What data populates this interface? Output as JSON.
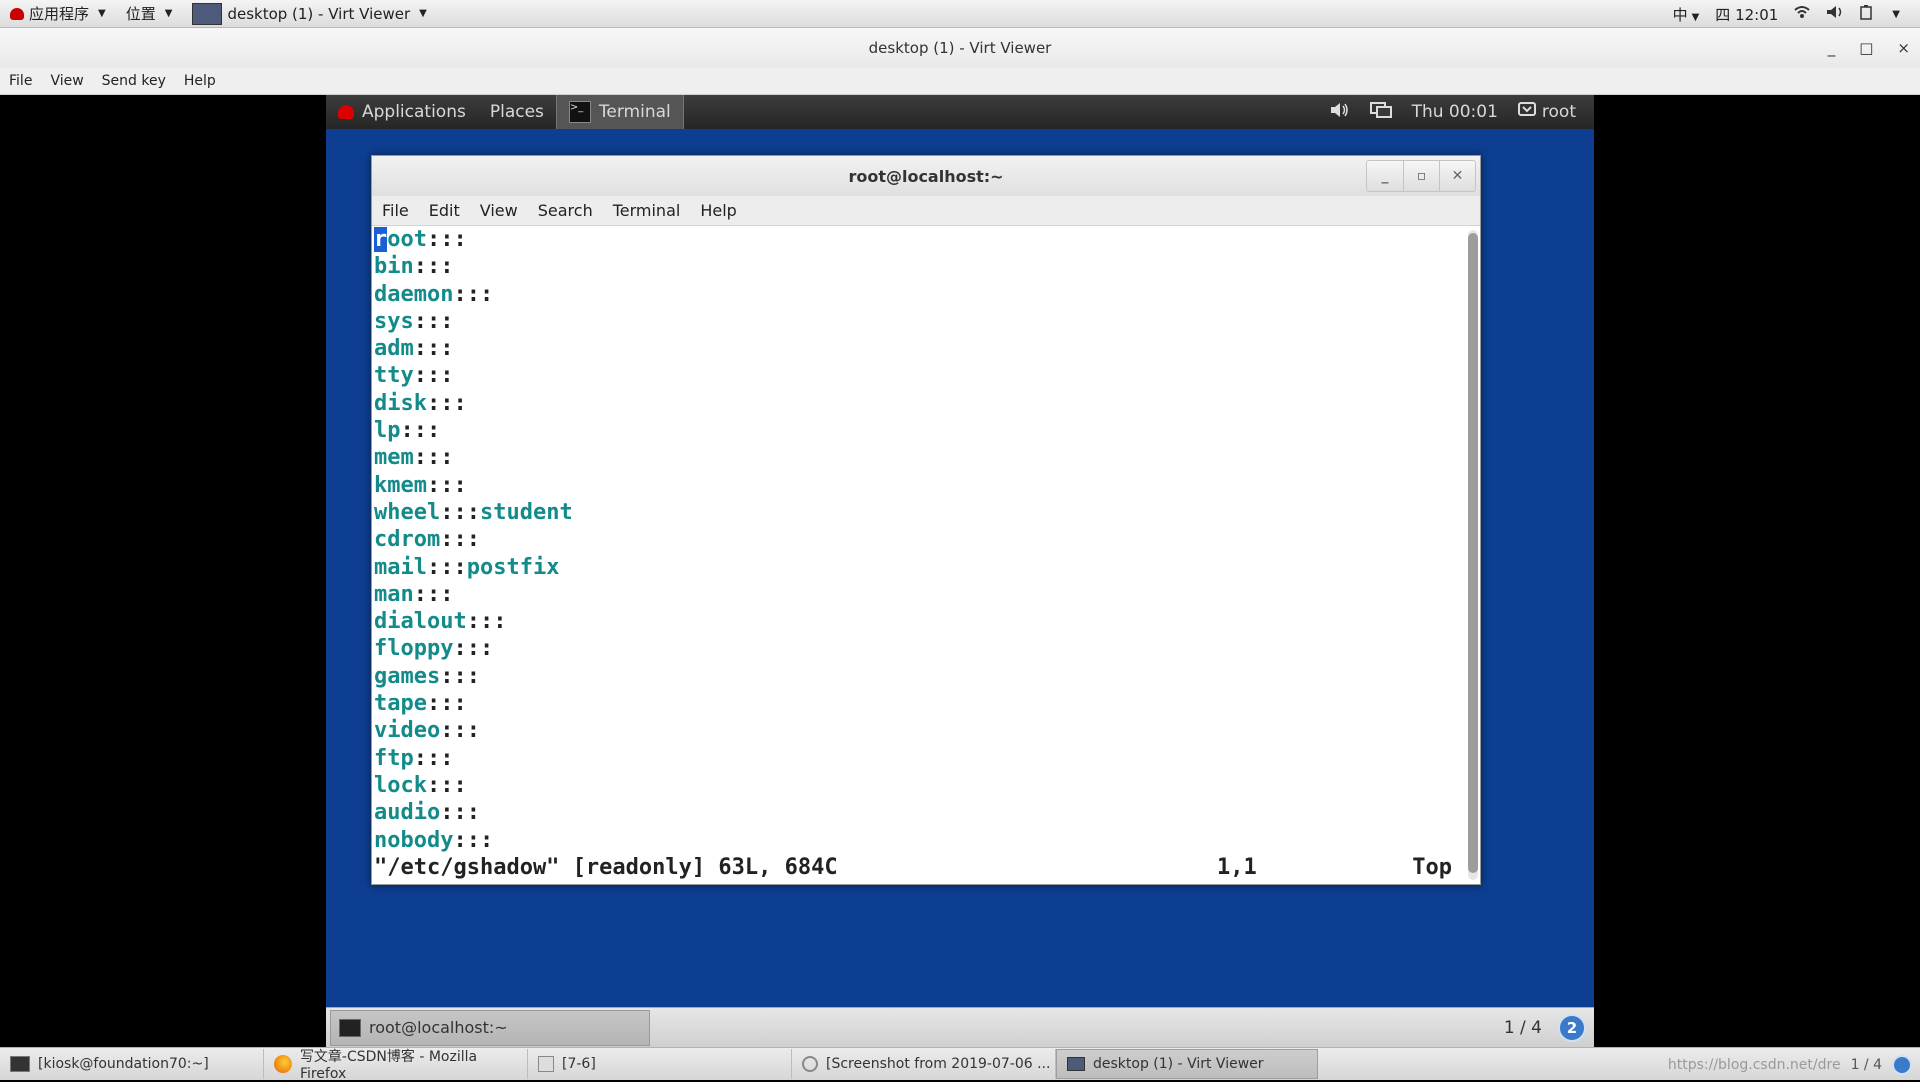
{
  "host_panel": {
    "apps": "应用程序",
    "places": "位置",
    "window_task": "desktop (1) - Virt Viewer",
    "input_method": "中",
    "clock": "四 12:01"
  },
  "viewer": {
    "title": "desktop (1) - Virt Viewer",
    "menu": [
      "File",
      "View",
      "Send key",
      "Help"
    ],
    "win_buttons": [
      "_",
      "□",
      "×"
    ]
  },
  "guest_panel": {
    "applications": "Applications",
    "places": "Places",
    "terminal": "Terminal",
    "clock": "Thu 00:01",
    "user": "root"
  },
  "terminal": {
    "title": "root@localhost:~",
    "menu": [
      "File",
      "Edit",
      "View",
      "Search",
      "Terminal",
      "Help"
    ],
    "lines": [
      {
        "name": "root",
        "sep": ":::",
        "members": ""
      },
      {
        "name": "bin",
        "sep": ":::",
        "members": ""
      },
      {
        "name": "daemon",
        "sep": ":::",
        "members": ""
      },
      {
        "name": "sys",
        "sep": ":::",
        "members": ""
      },
      {
        "name": "adm",
        "sep": ":::",
        "members": ""
      },
      {
        "name": "tty",
        "sep": ":::",
        "members": ""
      },
      {
        "name": "disk",
        "sep": ":::",
        "members": ""
      },
      {
        "name": "lp",
        "sep": ":::",
        "members": ""
      },
      {
        "name": "mem",
        "sep": ":::",
        "members": ""
      },
      {
        "name": "kmem",
        "sep": ":::",
        "members": ""
      },
      {
        "name": "wheel",
        "sep": ":::",
        "members": "student"
      },
      {
        "name": "cdrom",
        "sep": ":::",
        "members": ""
      },
      {
        "name": "mail",
        "sep": ":::",
        "members": "postfix"
      },
      {
        "name": "man",
        "sep": ":::",
        "members": ""
      },
      {
        "name": "dialout",
        "sep": ":::",
        "members": ""
      },
      {
        "name": "floppy",
        "sep": ":::",
        "members": ""
      },
      {
        "name": "games",
        "sep": ":::",
        "members": ""
      },
      {
        "name": "tape",
        "sep": ":::",
        "members": ""
      },
      {
        "name": "video",
        "sep": ":::",
        "members": ""
      },
      {
        "name": "ftp",
        "sep": ":::",
        "members": ""
      },
      {
        "name": "lock",
        "sep": ":::",
        "members": ""
      },
      {
        "name": "audio",
        "sep": ":::",
        "members": ""
      },
      {
        "name": "nobody",
        "sep": ":::",
        "members": ""
      }
    ],
    "status_file": "\"/etc/gshadow\" [readonly] 63L, 684C",
    "status_pos": "1,1",
    "status_scroll": "Top"
  },
  "guest_taskbar": {
    "task": "root@localhost:~",
    "pager": "1 / 4",
    "badge": "2"
  },
  "host_taskbar": {
    "tasks": [
      "[kiosk@foundation70:~]",
      "写文章-CSDN博客 - Mozilla Firefox",
      "[7-6]",
      "[Screenshot from 2019-07-06 ...",
      "desktop (1) - Virt Viewer"
    ],
    "watermark": "https://blog.csdn.net/dre",
    "pager": "1 / 4"
  },
  "colors": {
    "group_name": "#138b8b",
    "guest_bg": "#0d3e91",
    "cursor": "#1a5fd6"
  }
}
